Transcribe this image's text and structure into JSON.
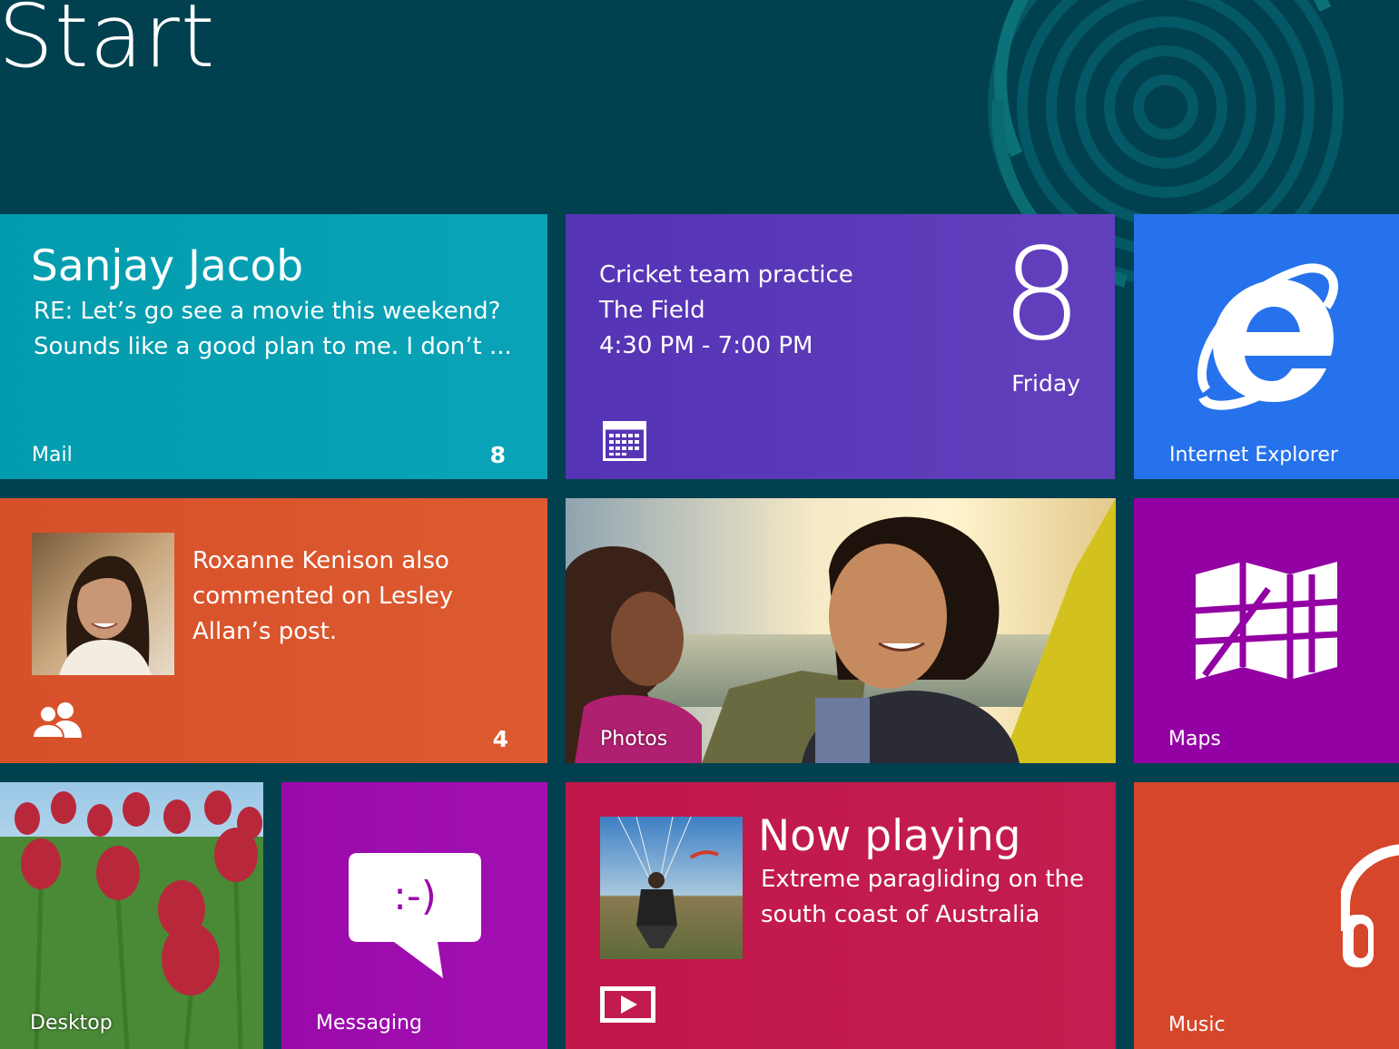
{
  "screen": {
    "title": "Start"
  },
  "colors": {
    "background": "#01404f",
    "mail": "#0aa3b7",
    "calendar": "#5d3cba",
    "internet_explorer": "#2672ec",
    "people": "#d9552c",
    "maps": "#9300a3",
    "messaging": "#a010b0",
    "video": "#c21b4d",
    "music": "#d5462a"
  },
  "tiles": {
    "mail": {
      "sender": "Sanjay Jacob",
      "subject": "RE: Let’s go see a movie this weekend?",
      "preview": "Sounds like a good plan to me. I don’t ...",
      "label": "Mail",
      "count": "8",
      "icon": "envelope-icon"
    },
    "calendar": {
      "event": "Cricket team practice",
      "location": "The Field",
      "time": "4:30 PM - 7:00 PM",
      "day_number": "8",
      "day_name": "Friday",
      "icon": "calendar-icon"
    },
    "internet_explorer": {
      "label": "Internet Explorer",
      "icon": "ie-logo-icon"
    },
    "people": {
      "notification_line1": "Roxanne Kenison also",
      "notification_line2": "commented on Lesley",
      "notification_line3": "Allan’s post.",
      "count": "4",
      "icon": "people-icon"
    },
    "photos": {
      "label": "Photos"
    },
    "maps": {
      "label": "Maps",
      "icon": "map-icon"
    },
    "desktop": {
      "label": "Desktop"
    },
    "messaging": {
      "label": "Messaging",
      "icon": "chat-bubble-icon",
      "emoticon": ":-)"
    },
    "video": {
      "title": "Now playing",
      "line1": "Extreme paragliding on the",
      "line2": "south coast of Australia",
      "icon": "play-icon"
    },
    "music": {
      "label": "Music",
      "icon": "headphones-icon"
    }
  }
}
